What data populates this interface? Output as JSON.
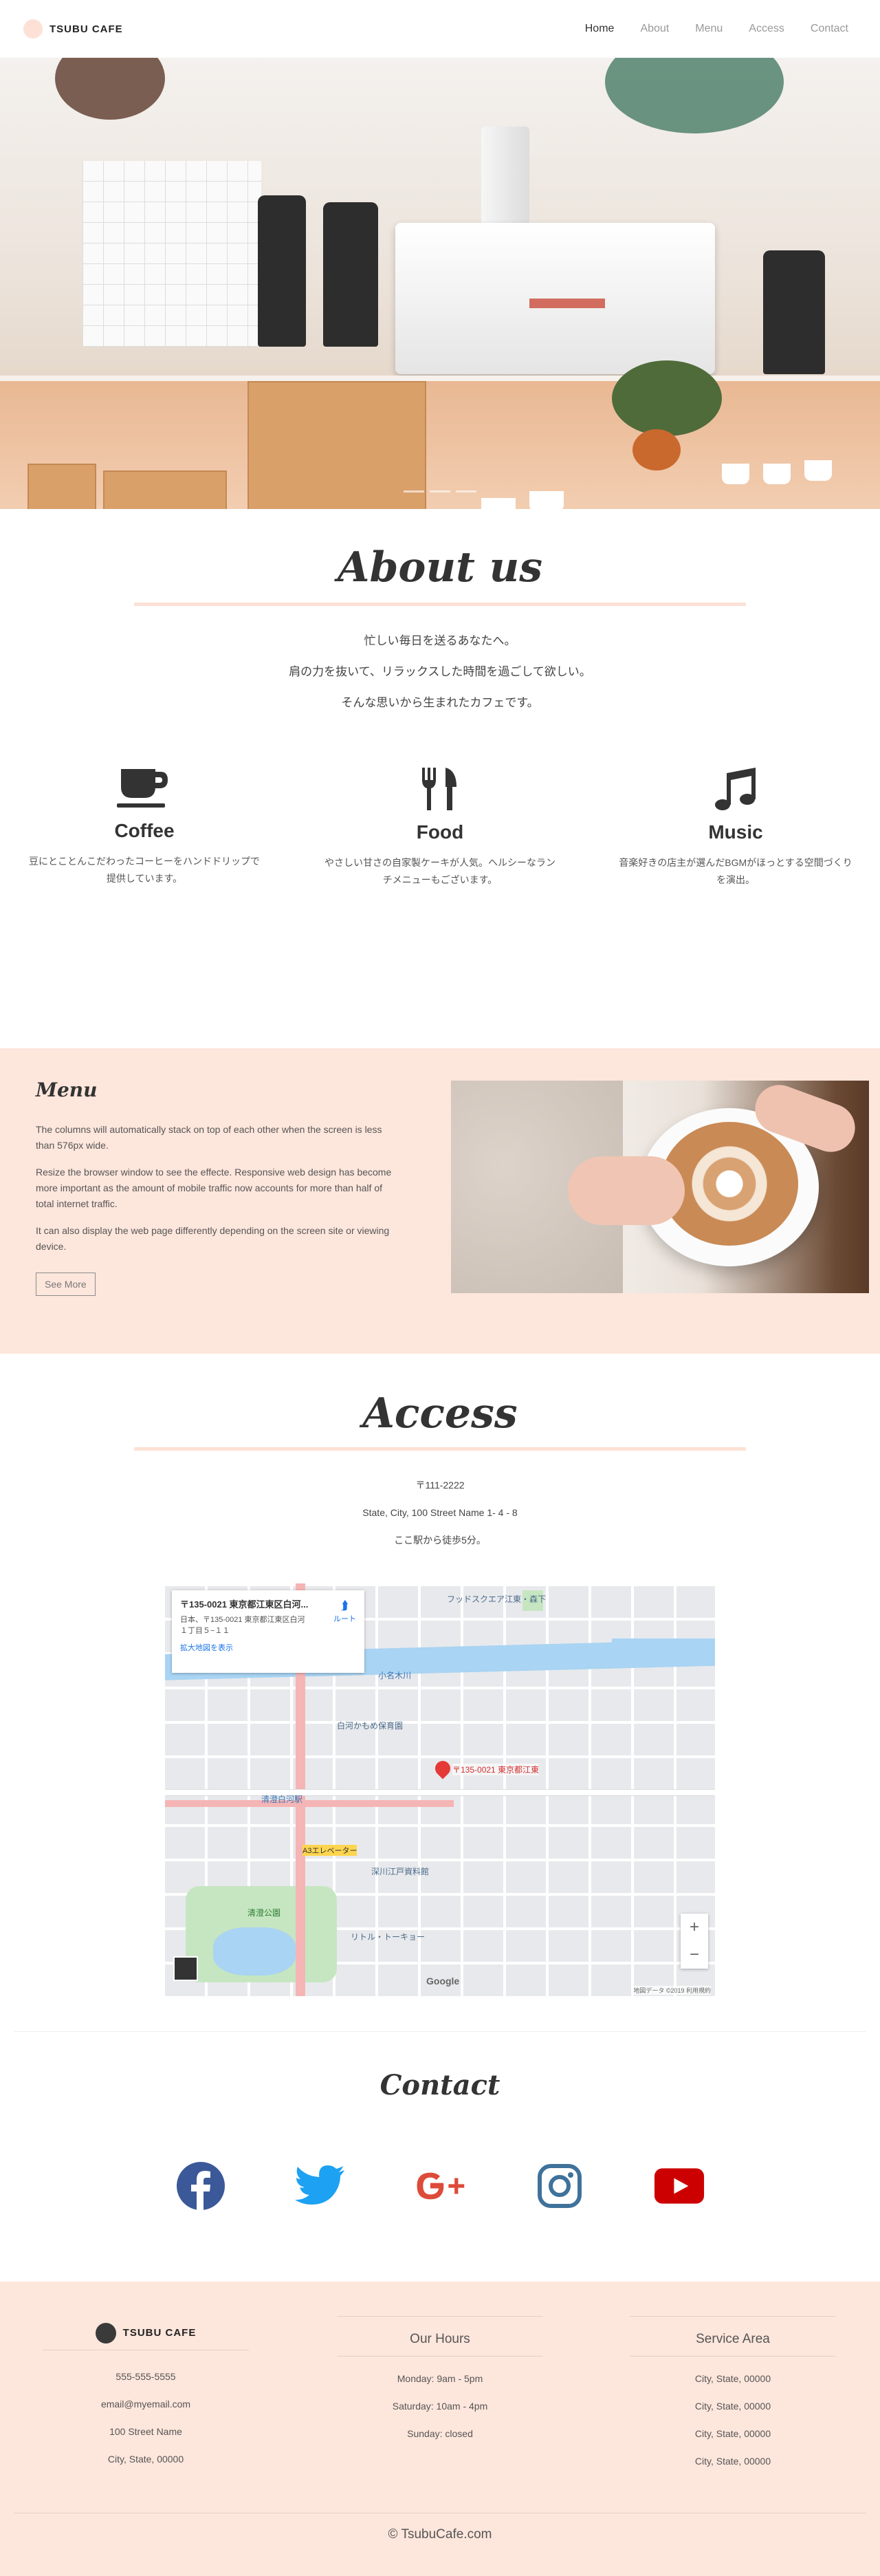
{
  "brand": {
    "name": "TSUBU CAFE"
  },
  "nav": [
    "Home",
    "About",
    "Menu",
    "Access",
    "Contact"
  ],
  "about": {
    "title": "About us",
    "lines": [
      "忙しい毎日を送るあなたへ。",
      "肩の力を抜いて、リラックスした時間を過ごして欲しい。",
      "そんな思いから生まれたカフェです。"
    ],
    "features": [
      {
        "icon": "coffee-icon",
        "title": "Coffee",
        "text": "豆にとことんこだわったコーヒーをハンドドリップで提供しています。"
      },
      {
        "icon": "food-icon",
        "title": "Food",
        "text": "やさしい甘さの自家製ケーキが人気。ヘルシーなランチメニューもございます。"
      },
      {
        "icon": "music-icon",
        "title": "Music",
        "text": "音楽好きの店主が選んだBGMがほっとする空間づくりを演出。"
      }
    ]
  },
  "menu": {
    "title": "Menu",
    "paragraphs": [
      "The columns will automatically stack on top of each other when the screen is less than 576px wide.",
      "Resize the browser window to see the effecte. Responsive web design has become more important as the amount of mobile traffic now accounts for more than half of total internet traffic.",
      "It can also display the web page differently depending on the screen site or viewing device."
    ],
    "button": "See More"
  },
  "access": {
    "title": "Access",
    "postal": "〒111-2222",
    "address": "State, City, 100 Street Name 1- 4 - 8",
    "walk": "ここ駅から徒歩5分。",
    "map": {
      "info_title": "〒135-0021 東京都江東区白河...",
      "info_address1": "日本、〒135-0021 東京都江東区白河",
      "info_address2": "１丁目５−１１",
      "info_link": "拡大地図を表示",
      "route": "ルート",
      "pin_label": "〒135-0021 東京都江東",
      "labels": [
        "フッドスクエア江東・森下",
        "小名木川",
        "清澄白河駅",
        "白河かもめ保育園",
        "A3エレベーター",
        "深川江戸資料館",
        "清澄公園",
        "リトル・トーキョー"
      ],
      "google": "Google",
      "copyright": "地図データ ©2019   利用規約",
      "zoom_in": "+",
      "zoom_out": "−"
    }
  },
  "contact": {
    "title": "Contact",
    "socials": [
      {
        "icon": "facebook-icon",
        "color": "#3b5998"
      },
      {
        "icon": "twitter-icon",
        "color": "#1da1f2"
      },
      {
        "icon": "google-plus-icon",
        "color": "#dd4b39"
      },
      {
        "icon": "instagram-icon",
        "color": "#3f729b"
      },
      {
        "icon": "youtube-icon",
        "color": "#cc0000"
      }
    ]
  },
  "footer": {
    "brand": "TSUBU CAFE",
    "contact_items": [
      "555-555-5555",
      "email@myemail.com",
      "100 Street Name",
      "City, State, 00000"
    ],
    "hours_title": "Our Hours",
    "hours": [
      "Monday: 9am - 5pm",
      "Saturday: 10am - 4pm",
      "Sunday: closed"
    ],
    "area_title": "Service Area",
    "areas": [
      "City, State, 00000",
      "City, State, 00000",
      "City, State, 00000",
      "City, State, 00000"
    ],
    "copyright": "© TsubuCafe.com"
  },
  "colors": {
    "accent": "#fde1d6",
    "text": "#3a3a3a"
  }
}
